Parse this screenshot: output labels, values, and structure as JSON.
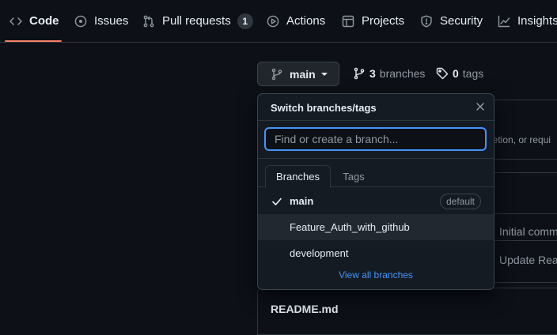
{
  "nav": {
    "tabs": [
      {
        "label": "Code",
        "icon": "code-icon",
        "active": true
      },
      {
        "label": "Issues",
        "icon": "issue-opened-icon"
      },
      {
        "label": "Pull requests",
        "icon": "git-pull-request-icon",
        "count": "1"
      },
      {
        "label": "Actions",
        "icon": "play-icon"
      },
      {
        "label": "Projects",
        "icon": "table-icon"
      },
      {
        "label": "Security",
        "icon": "shield-icon"
      },
      {
        "label": "Insights",
        "icon": "graph-icon"
      }
    ],
    "active_color": "#f78166"
  },
  "branch_bar": {
    "current_branch": "main",
    "branches_count": "3",
    "branches_label": "branches",
    "tags_count": "0",
    "tags_label": "tags"
  },
  "background": {
    "banner_text": "letion, or requi",
    "commit_1": "Initial comm",
    "commit_2": "Update Rea",
    "readme_title": "README.md"
  },
  "dropdown": {
    "title": "Switch branches/tags",
    "search_placeholder": "Find or create a branch...",
    "tabs": [
      "Branches",
      "Tags"
    ],
    "items": [
      {
        "name": "main",
        "selected": true,
        "badge": "default"
      },
      {
        "name": "Feature_Auth_with_github"
      },
      {
        "name": "development"
      }
    ],
    "view_all": "View all branches"
  },
  "colors": {
    "background": "#0d1117",
    "accent": "#4493f8",
    "border": "#30363d"
  }
}
